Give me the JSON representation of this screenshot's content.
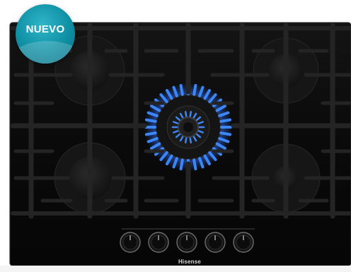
{
  "badge": {
    "label": "NUEVO",
    "color": "#1097ab"
  },
  "brand": {
    "name": "Hisense"
  },
  "hob": {
    "surface_color": "#0b0b0b",
    "grate_color": "#1e1e1e",
    "flame_color": "#3f8cff",
    "burners": [
      {
        "id": "rear-left",
        "lit": false
      },
      {
        "id": "rear-right",
        "lit": false
      },
      {
        "id": "center-wok",
        "lit": true
      },
      {
        "id": "front-left",
        "lit": false
      },
      {
        "id": "front-right",
        "lit": false
      }
    ],
    "knob_count": 5
  }
}
